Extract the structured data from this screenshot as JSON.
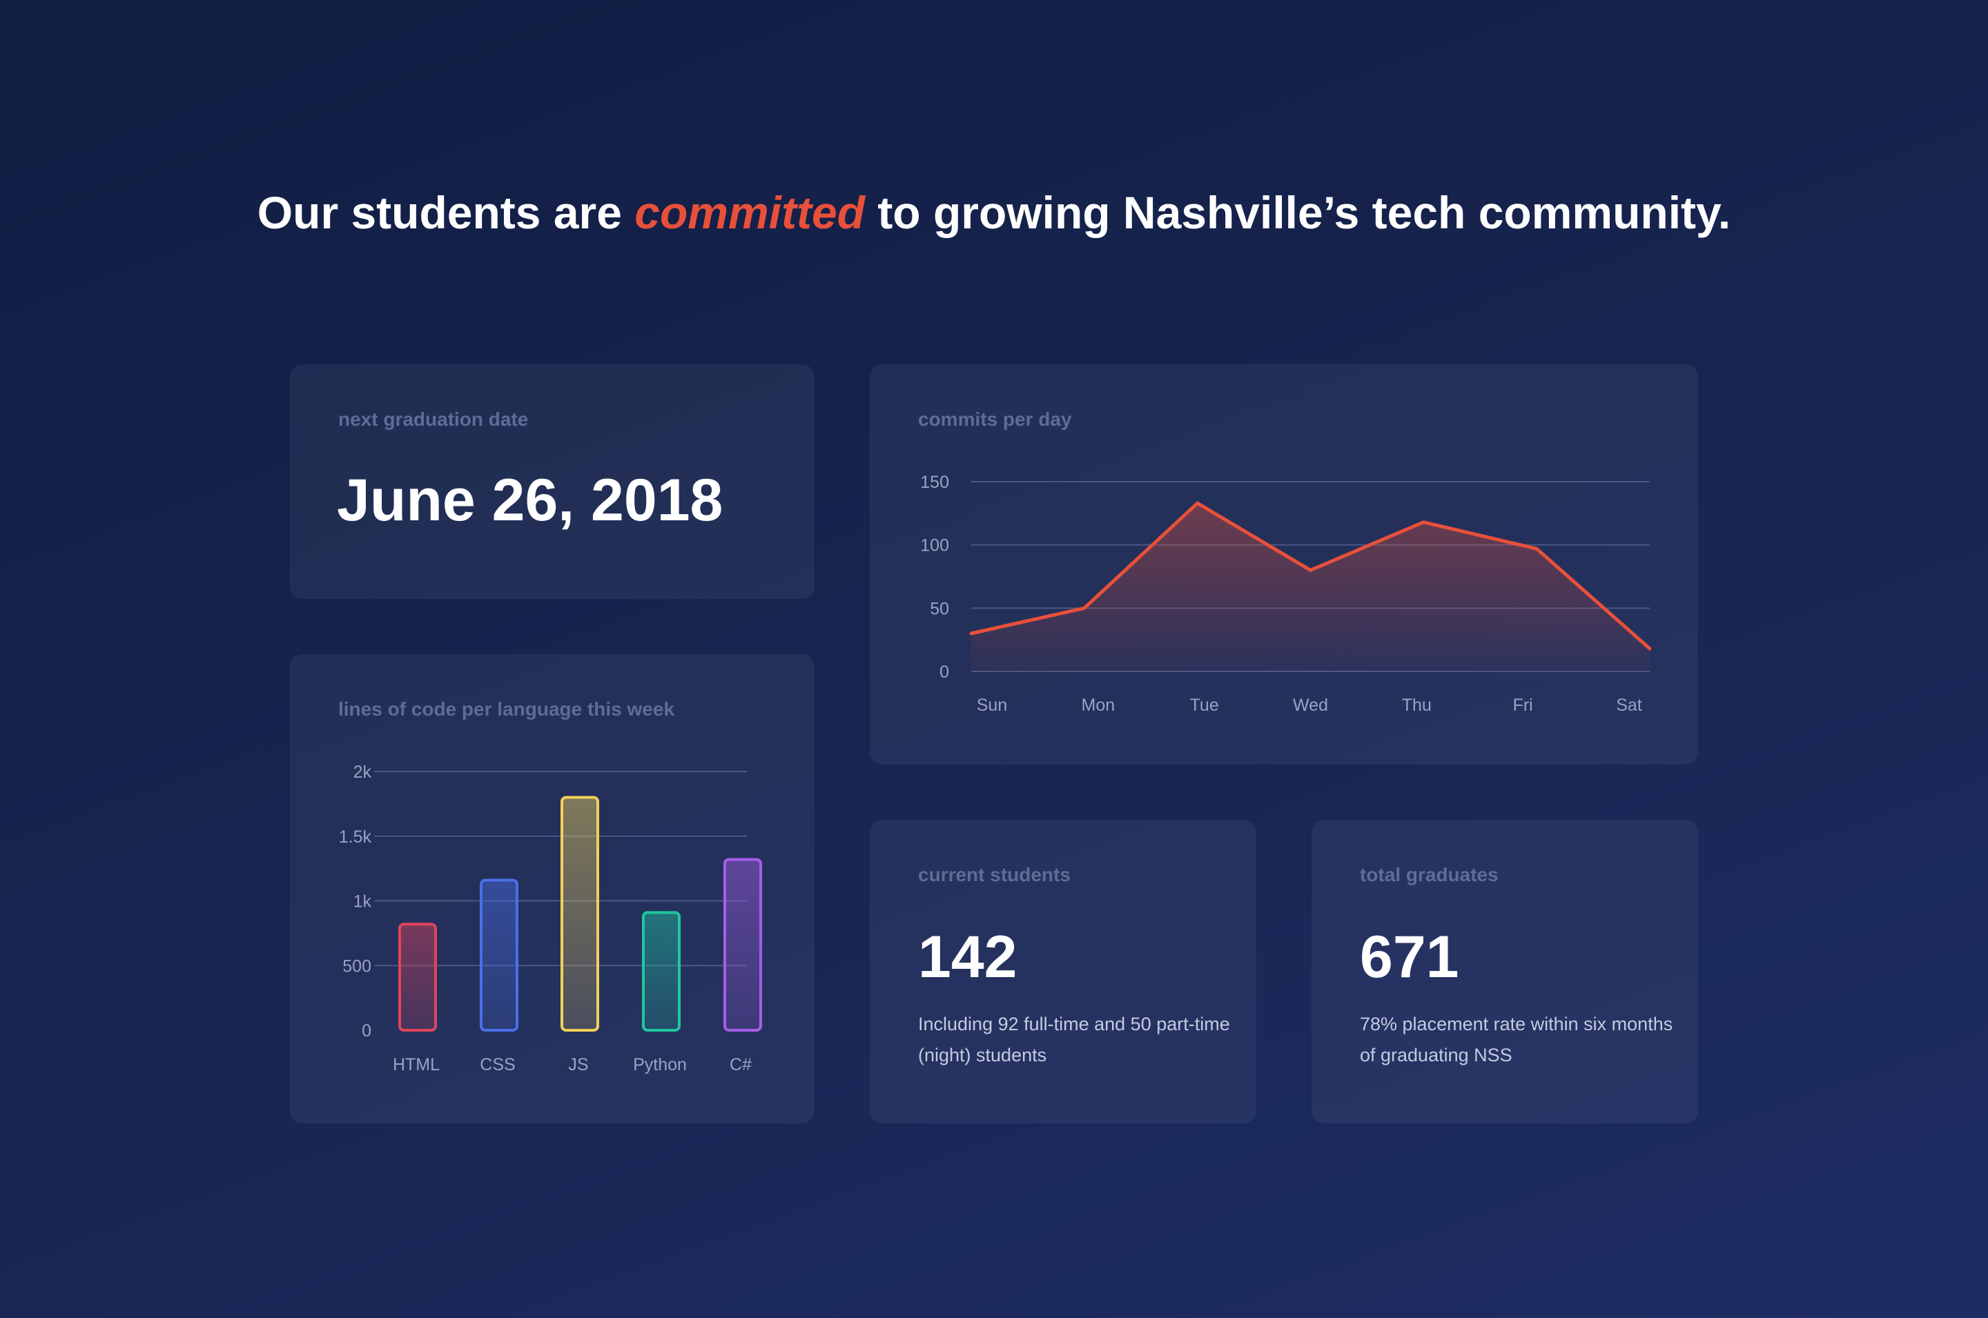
{
  "headline": {
    "before": "Our students are ",
    "accent": "committed",
    "after": " to growing Nashville’s tech community.",
    "accent_color": "#e8503a"
  },
  "graduation": {
    "label": "next graduation date",
    "value": "June 26, 2018"
  },
  "commits": {
    "label": "commits per day"
  },
  "languages": {
    "label": "lines of code per language this week"
  },
  "current_students": {
    "label": "current students",
    "value": "142",
    "note": "Including 92 full-time and 50 part-time (night) students"
  },
  "total_graduates": {
    "label": "total graduates",
    "value": "671",
    "note": "78% placement rate within six months of graduating NSS"
  },
  "chart_data": [
    {
      "type": "area",
      "categories": [
        "Sun",
        "Mon",
        "Tue",
        "Wed",
        "Thu",
        "Fri",
        "Sat"
      ],
      "values": [
        30,
        50,
        133,
        80,
        118,
        97,
        18
      ],
      "yticks": [
        0,
        50,
        100,
        150
      ],
      "ylim": [
        0,
        150
      ],
      "grid": true,
      "color": "#e8503a"
    },
    {
      "type": "bar",
      "categories": [
        "HTML",
        "CSS",
        "JS",
        "Python",
        "C#"
      ],
      "values": [
        820,
        1160,
        1800,
        910,
        1320
      ],
      "yticks": [
        "0",
        "500",
        "1k",
        "1.5k",
        "2k"
      ],
      "ytick_values": [
        0,
        500,
        1000,
        1500,
        2000
      ],
      "ylim": [
        0,
        2000
      ],
      "grid": true,
      "colors": [
        "#e0455c",
        "#4a6fe8",
        "#f2d15a",
        "#1fc7a0",
        "#a65ee8"
      ]
    }
  ]
}
